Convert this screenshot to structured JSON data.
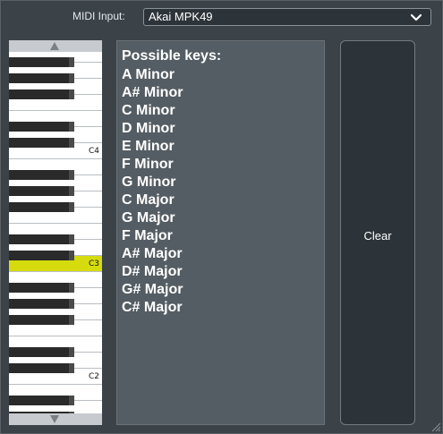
{
  "midi": {
    "label": "MIDI Input:",
    "selected": "Akai MPK49",
    "icon": "chevron-down-icon"
  },
  "piano": {
    "octave_labels": [
      "C4",
      "C3",
      "C2"
    ],
    "highlighted_key": "C3",
    "highlight_color": "#d6db0e",
    "scroll_up_icon": "triangle-up-icon",
    "scroll_down_icon": "triangle-down-icon"
  },
  "keys_panel": {
    "title": "Possible keys:",
    "items": [
      "A Minor",
      "A# Minor",
      "C Minor",
      "D Minor",
      "E Minor",
      "F Minor",
      "G Minor",
      "C Major",
      "G Major",
      "F Major",
      "A# Major",
      "D# Major",
      "G# Major",
      "C# Major"
    ]
  },
  "clear_button": {
    "label": "Clear"
  },
  "colors": {
    "background": "#3b4349",
    "panel": "#545d63",
    "button": "#2c343a"
  }
}
